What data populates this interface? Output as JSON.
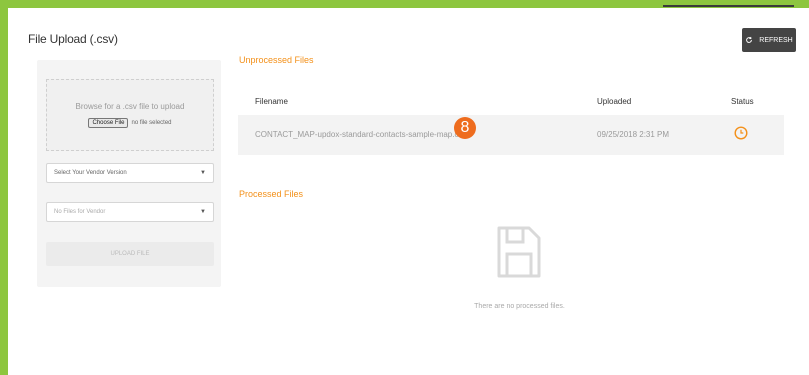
{
  "page": {
    "title": "File Upload (.csv)"
  },
  "toolbar": {
    "refresh_label": "REFRESH"
  },
  "upload_panel": {
    "browse_text": "Browse for a .csv file to upload",
    "choose_button": "Choose File",
    "no_file_text": "no file selected",
    "vendor_select": "Select Your Vendor Version",
    "files_select": "No Files for Vendor",
    "upload_button": "UPLOAD FILE"
  },
  "unprocessed": {
    "title": "Unprocessed Files",
    "columns": [
      "Filename",
      "Uploaded",
      "Status"
    ],
    "rows": [
      {
        "filename": "CONTACT_MAP-updox-standard-contacts-sample-map.csv",
        "uploaded": "09/25/2018 2:31 PM",
        "status_icon": "clock-icon"
      }
    ],
    "step_badge": "8"
  },
  "processed": {
    "title": "Processed Files",
    "empty_text": "There are no processed files.",
    "empty_icon": "floppy-disk-icon"
  },
  "colors": {
    "accent_green": "#8dc63f",
    "orange": "#f39019",
    "badge": "#ee6c1e",
    "button_dark": "#444444"
  }
}
